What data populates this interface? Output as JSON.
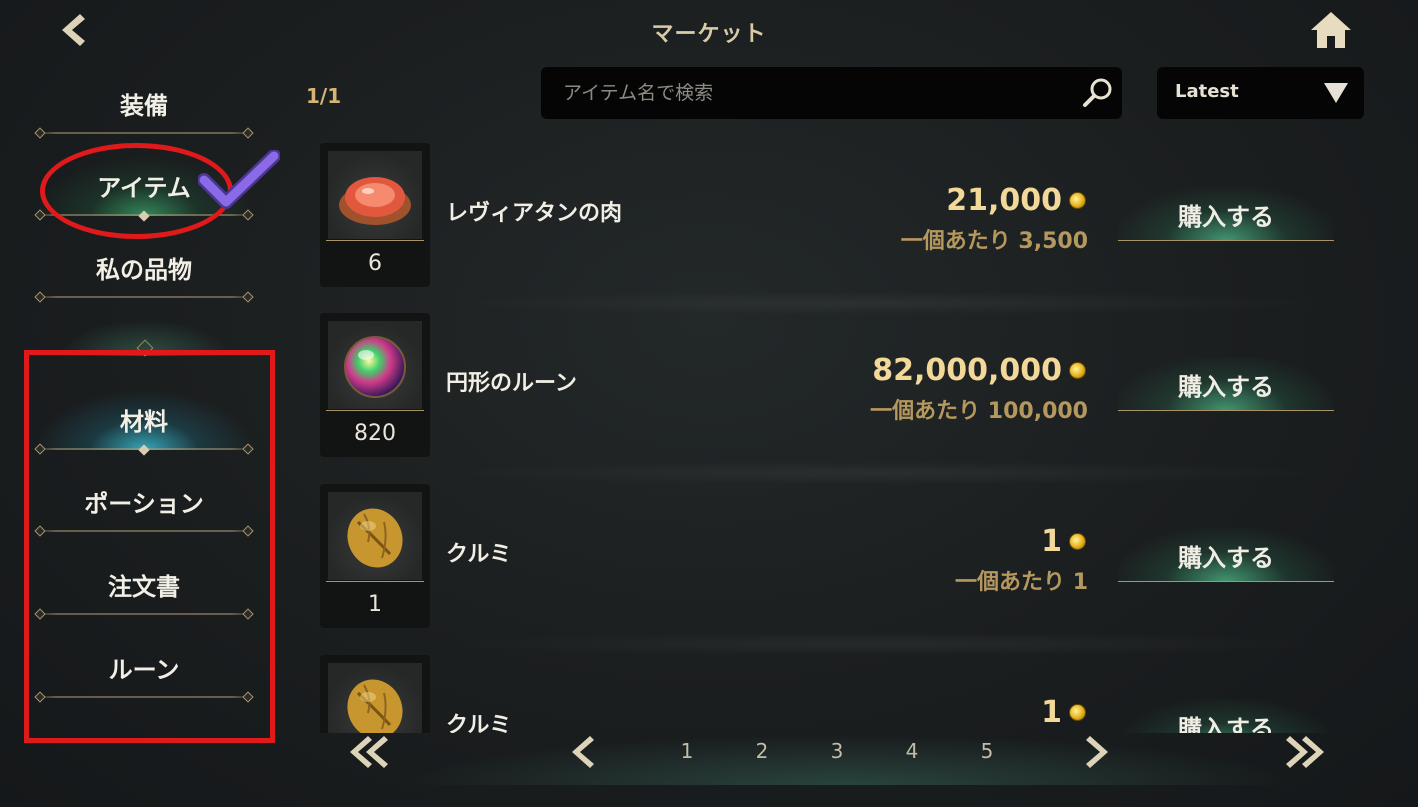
{
  "header": {
    "title": "マーケット",
    "back_icon": "chevron-left-icon",
    "home_icon": "home-icon"
  },
  "page_count": "1/1",
  "search": {
    "placeholder": "アイテム名で検索",
    "value": ""
  },
  "sort": {
    "selected": "Latest"
  },
  "sidebar": {
    "top_tabs": [
      {
        "label": "装備",
        "active": false
      },
      {
        "label": "アイテム",
        "active": true
      },
      {
        "label": "私の品物",
        "active": false
      }
    ],
    "categories": [
      {
        "label": "材料",
        "active": true
      },
      {
        "label": "ポーション",
        "active": false
      },
      {
        "label": "注文書",
        "active": false
      },
      {
        "label": "ルーン",
        "active": false
      }
    ]
  },
  "items": [
    {
      "name": "レヴィアタンの肉",
      "qty": "6",
      "price": "21,000",
      "unit_price": "一個あたり 3,500",
      "buy_label": "購入する",
      "icon": "meat-icon"
    },
    {
      "name": "円形のルーン",
      "qty": "820",
      "price": "82,000,000",
      "unit_price": "一個あたり 100,000",
      "buy_label": "購入する",
      "icon": "rune-orb-icon"
    },
    {
      "name": "クルミ",
      "qty": "1",
      "price": "1",
      "unit_price": "一個あたり 1",
      "buy_label": "購入する",
      "icon": "walnut-icon"
    },
    {
      "name": "クルミ",
      "qty": "",
      "price": "1",
      "unit_price": "",
      "buy_label": "購入する",
      "icon": "walnut-icon"
    }
  ],
  "pagination": {
    "pages": [
      "1",
      "2",
      "3",
      "4",
      "5"
    ]
  },
  "colors": {
    "accent_gold": "#f2d999",
    "annotation_red": "#e0191b",
    "check_purple": "#7b5ad6"
  }
}
